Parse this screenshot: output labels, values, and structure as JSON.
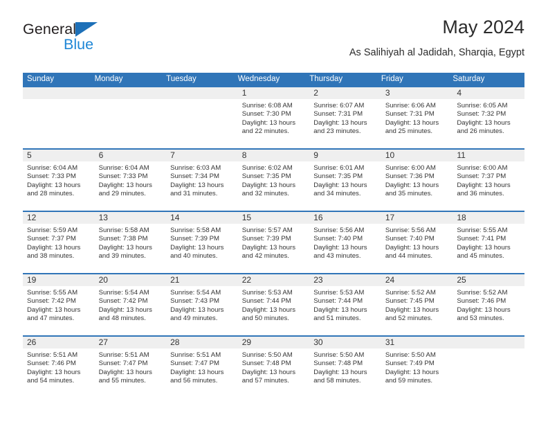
{
  "brand": {
    "name_part1": "General",
    "name_part2": "Blue",
    "triangle_icon": "blue-triangle-icon",
    "accent_color": "#1d86d6",
    "dark_color": "#231f20"
  },
  "header": {
    "title": "May 2024",
    "subtitle": "As Salihiyah al Jadidah, Sharqia, Egypt"
  },
  "calendar": {
    "header_bg": "#3075b8",
    "daynum_bg": "#efefef",
    "weekdays": [
      "Sunday",
      "Monday",
      "Tuesday",
      "Wednesday",
      "Thursday",
      "Friday",
      "Saturday"
    ],
    "weeks": [
      [
        {
          "day": "",
          "empty": true,
          "sunrise": "",
          "sunset": "",
          "daylight1": "",
          "daylight2": ""
        },
        {
          "day": "",
          "empty": true,
          "sunrise": "",
          "sunset": "",
          "daylight1": "",
          "daylight2": ""
        },
        {
          "day": "",
          "empty": true,
          "sunrise": "",
          "sunset": "",
          "daylight1": "",
          "daylight2": ""
        },
        {
          "day": "1",
          "empty": false,
          "sunrise": "Sunrise: 6:08 AM",
          "sunset": "Sunset: 7:30 PM",
          "daylight1": "Daylight: 13 hours",
          "daylight2": "and 22 minutes."
        },
        {
          "day": "2",
          "empty": false,
          "sunrise": "Sunrise: 6:07 AM",
          "sunset": "Sunset: 7:31 PM",
          "daylight1": "Daylight: 13 hours",
          "daylight2": "and 23 minutes."
        },
        {
          "day": "3",
          "empty": false,
          "sunrise": "Sunrise: 6:06 AM",
          "sunset": "Sunset: 7:31 PM",
          "daylight1": "Daylight: 13 hours",
          "daylight2": "and 25 minutes."
        },
        {
          "day": "4",
          "empty": false,
          "sunrise": "Sunrise: 6:05 AM",
          "sunset": "Sunset: 7:32 PM",
          "daylight1": "Daylight: 13 hours",
          "daylight2": "and 26 minutes."
        }
      ],
      [
        {
          "day": "5",
          "empty": false,
          "sunrise": "Sunrise: 6:04 AM",
          "sunset": "Sunset: 7:33 PM",
          "daylight1": "Daylight: 13 hours",
          "daylight2": "and 28 minutes."
        },
        {
          "day": "6",
          "empty": false,
          "sunrise": "Sunrise: 6:04 AM",
          "sunset": "Sunset: 7:33 PM",
          "daylight1": "Daylight: 13 hours",
          "daylight2": "and 29 minutes."
        },
        {
          "day": "7",
          "empty": false,
          "sunrise": "Sunrise: 6:03 AM",
          "sunset": "Sunset: 7:34 PM",
          "daylight1": "Daylight: 13 hours",
          "daylight2": "and 31 minutes."
        },
        {
          "day": "8",
          "empty": false,
          "sunrise": "Sunrise: 6:02 AM",
          "sunset": "Sunset: 7:35 PM",
          "daylight1": "Daylight: 13 hours",
          "daylight2": "and 32 minutes."
        },
        {
          "day": "9",
          "empty": false,
          "sunrise": "Sunrise: 6:01 AM",
          "sunset": "Sunset: 7:35 PM",
          "daylight1": "Daylight: 13 hours",
          "daylight2": "and 34 minutes."
        },
        {
          "day": "10",
          "empty": false,
          "sunrise": "Sunrise: 6:00 AM",
          "sunset": "Sunset: 7:36 PM",
          "daylight1": "Daylight: 13 hours",
          "daylight2": "and 35 minutes."
        },
        {
          "day": "11",
          "empty": false,
          "sunrise": "Sunrise: 6:00 AM",
          "sunset": "Sunset: 7:37 PM",
          "daylight1": "Daylight: 13 hours",
          "daylight2": "and 36 minutes."
        }
      ],
      [
        {
          "day": "12",
          "empty": false,
          "sunrise": "Sunrise: 5:59 AM",
          "sunset": "Sunset: 7:37 PM",
          "daylight1": "Daylight: 13 hours",
          "daylight2": "and 38 minutes."
        },
        {
          "day": "13",
          "empty": false,
          "sunrise": "Sunrise: 5:58 AM",
          "sunset": "Sunset: 7:38 PM",
          "daylight1": "Daylight: 13 hours",
          "daylight2": "and 39 minutes."
        },
        {
          "day": "14",
          "empty": false,
          "sunrise": "Sunrise: 5:58 AM",
          "sunset": "Sunset: 7:39 PM",
          "daylight1": "Daylight: 13 hours",
          "daylight2": "and 40 minutes."
        },
        {
          "day": "15",
          "empty": false,
          "sunrise": "Sunrise: 5:57 AM",
          "sunset": "Sunset: 7:39 PM",
          "daylight1": "Daylight: 13 hours",
          "daylight2": "and 42 minutes."
        },
        {
          "day": "16",
          "empty": false,
          "sunrise": "Sunrise: 5:56 AM",
          "sunset": "Sunset: 7:40 PM",
          "daylight1": "Daylight: 13 hours",
          "daylight2": "and 43 minutes."
        },
        {
          "day": "17",
          "empty": false,
          "sunrise": "Sunrise: 5:56 AM",
          "sunset": "Sunset: 7:40 PM",
          "daylight1": "Daylight: 13 hours",
          "daylight2": "and 44 minutes."
        },
        {
          "day": "18",
          "empty": false,
          "sunrise": "Sunrise: 5:55 AM",
          "sunset": "Sunset: 7:41 PM",
          "daylight1": "Daylight: 13 hours",
          "daylight2": "and 45 minutes."
        }
      ],
      [
        {
          "day": "19",
          "empty": false,
          "sunrise": "Sunrise: 5:55 AM",
          "sunset": "Sunset: 7:42 PM",
          "daylight1": "Daylight: 13 hours",
          "daylight2": "and 47 minutes."
        },
        {
          "day": "20",
          "empty": false,
          "sunrise": "Sunrise: 5:54 AM",
          "sunset": "Sunset: 7:42 PM",
          "daylight1": "Daylight: 13 hours",
          "daylight2": "and 48 minutes."
        },
        {
          "day": "21",
          "empty": false,
          "sunrise": "Sunrise: 5:54 AM",
          "sunset": "Sunset: 7:43 PM",
          "daylight1": "Daylight: 13 hours",
          "daylight2": "and 49 minutes."
        },
        {
          "day": "22",
          "empty": false,
          "sunrise": "Sunrise: 5:53 AM",
          "sunset": "Sunset: 7:44 PM",
          "daylight1": "Daylight: 13 hours",
          "daylight2": "and 50 minutes."
        },
        {
          "day": "23",
          "empty": false,
          "sunrise": "Sunrise: 5:53 AM",
          "sunset": "Sunset: 7:44 PM",
          "daylight1": "Daylight: 13 hours",
          "daylight2": "and 51 minutes."
        },
        {
          "day": "24",
          "empty": false,
          "sunrise": "Sunrise: 5:52 AM",
          "sunset": "Sunset: 7:45 PM",
          "daylight1": "Daylight: 13 hours",
          "daylight2": "and 52 minutes."
        },
        {
          "day": "25",
          "empty": false,
          "sunrise": "Sunrise: 5:52 AM",
          "sunset": "Sunset: 7:46 PM",
          "daylight1": "Daylight: 13 hours",
          "daylight2": "and 53 minutes."
        }
      ],
      [
        {
          "day": "26",
          "empty": false,
          "sunrise": "Sunrise: 5:51 AM",
          "sunset": "Sunset: 7:46 PM",
          "daylight1": "Daylight: 13 hours",
          "daylight2": "and 54 minutes."
        },
        {
          "day": "27",
          "empty": false,
          "sunrise": "Sunrise: 5:51 AM",
          "sunset": "Sunset: 7:47 PM",
          "daylight1": "Daylight: 13 hours",
          "daylight2": "and 55 minutes."
        },
        {
          "day": "28",
          "empty": false,
          "sunrise": "Sunrise: 5:51 AM",
          "sunset": "Sunset: 7:47 PM",
          "daylight1": "Daylight: 13 hours",
          "daylight2": "and 56 minutes."
        },
        {
          "day": "29",
          "empty": false,
          "sunrise": "Sunrise: 5:50 AM",
          "sunset": "Sunset: 7:48 PM",
          "daylight1": "Daylight: 13 hours",
          "daylight2": "and 57 minutes."
        },
        {
          "day": "30",
          "empty": false,
          "sunrise": "Sunrise: 5:50 AM",
          "sunset": "Sunset: 7:48 PM",
          "daylight1": "Daylight: 13 hours",
          "daylight2": "and 58 minutes."
        },
        {
          "day": "31",
          "empty": false,
          "sunrise": "Sunrise: 5:50 AM",
          "sunset": "Sunset: 7:49 PM",
          "daylight1": "Daylight: 13 hours",
          "daylight2": "and 59 minutes."
        },
        {
          "day": "",
          "empty": true,
          "sunrise": "",
          "sunset": "",
          "daylight1": "",
          "daylight2": ""
        }
      ]
    ]
  }
}
